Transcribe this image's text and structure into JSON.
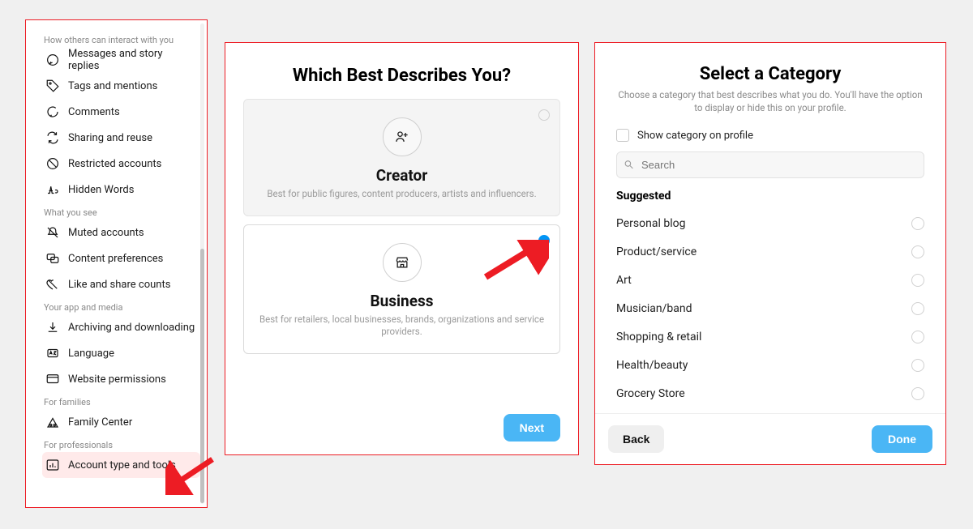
{
  "sidebar": {
    "sections": [
      {
        "title": "How others can interact with you",
        "items": [
          {
            "icon": "chat-icon",
            "label": "Messages and story replies"
          },
          {
            "icon": "tag-icon",
            "label": "Tags and mentions"
          },
          {
            "icon": "comment-icon",
            "label": "Comments"
          },
          {
            "icon": "reuse-icon",
            "label": "Sharing and reuse"
          },
          {
            "icon": "restricted-icon",
            "label": "Restricted accounts"
          },
          {
            "icon": "hidden-words-icon",
            "label": "Hidden Words"
          }
        ]
      },
      {
        "title": "What you see",
        "items": [
          {
            "icon": "muted-icon",
            "label": "Muted accounts"
          },
          {
            "icon": "content-pref-icon",
            "label": "Content preferences"
          },
          {
            "icon": "like-share-icon",
            "label": "Like and share counts"
          }
        ]
      },
      {
        "title": "Your app and media",
        "items": [
          {
            "icon": "download-icon",
            "label": "Archiving and downloading"
          },
          {
            "icon": "language-icon",
            "label": "Language"
          },
          {
            "icon": "website-icon",
            "label": "Website permissions"
          }
        ]
      },
      {
        "title": "For families",
        "items": [
          {
            "icon": "family-icon",
            "label": "Family Center"
          }
        ]
      },
      {
        "title": "For professionals",
        "items": [
          {
            "icon": "chart-icon",
            "label": "Account type and tools",
            "active": true
          }
        ]
      }
    ]
  },
  "describe": {
    "heading": "Which Best Describes You?",
    "creator": {
      "title": "Creator",
      "desc": "Best for public figures, content producers, artists and influencers.",
      "selected": false
    },
    "business": {
      "title": "Business",
      "desc": "Best for retailers, local businesses, brands, organizations and service providers.",
      "selected": true
    },
    "next_label": "Next"
  },
  "category": {
    "heading": "Select a Category",
    "subtitle": "Choose a category that best describes what you do. You'll have the option to display or hide this on your profile.",
    "show_on_profile_label": "Show category on profile",
    "search_placeholder": "Search",
    "suggested_label": "Suggested",
    "items": [
      "Personal blog",
      "Product/service",
      "Art",
      "Musician/band",
      "Shopping & retail",
      "Health/beauty",
      "Grocery Store"
    ],
    "back_label": "Back",
    "done_label": "Done"
  },
  "colors": {
    "accent": "#0095f6",
    "highlight_red": "#ed1c24"
  }
}
